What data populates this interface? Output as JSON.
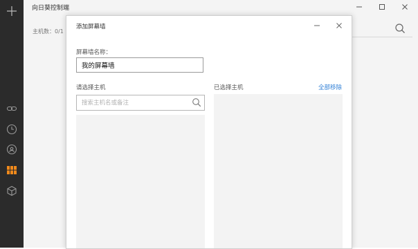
{
  "main_window": {
    "title": "向日葵控制端",
    "host_count": "主机数：0/1",
    "controls": {
      "minimize_icon": "minimize-icon",
      "maximize_icon": "maximize-icon",
      "close_icon": "close-icon"
    }
  },
  "sidebar": {
    "items": [
      {
        "icon": "plus-icon",
        "active": false
      },
      {
        "icon": "link-icon",
        "active": false
      },
      {
        "icon": "clock-icon",
        "active": false
      },
      {
        "icon": "remote-icon",
        "active": false
      },
      {
        "icon": "screen-wall-icon",
        "active": true
      },
      {
        "icon": "cube-icon",
        "active": false
      }
    ],
    "accent_color": "#f08a1c"
  },
  "dialog": {
    "title": "添加屏幕墙",
    "wall_name_label": "屏幕墙名称：",
    "wall_name_value": "我的屏幕墙",
    "select_hosts_label": "请选择主机",
    "search_placeholder": "搜索主机名或备注",
    "selected_hosts_label": "已选择主机",
    "remove_all_label": "全部移除",
    "link_color": "#2f7fd6"
  }
}
